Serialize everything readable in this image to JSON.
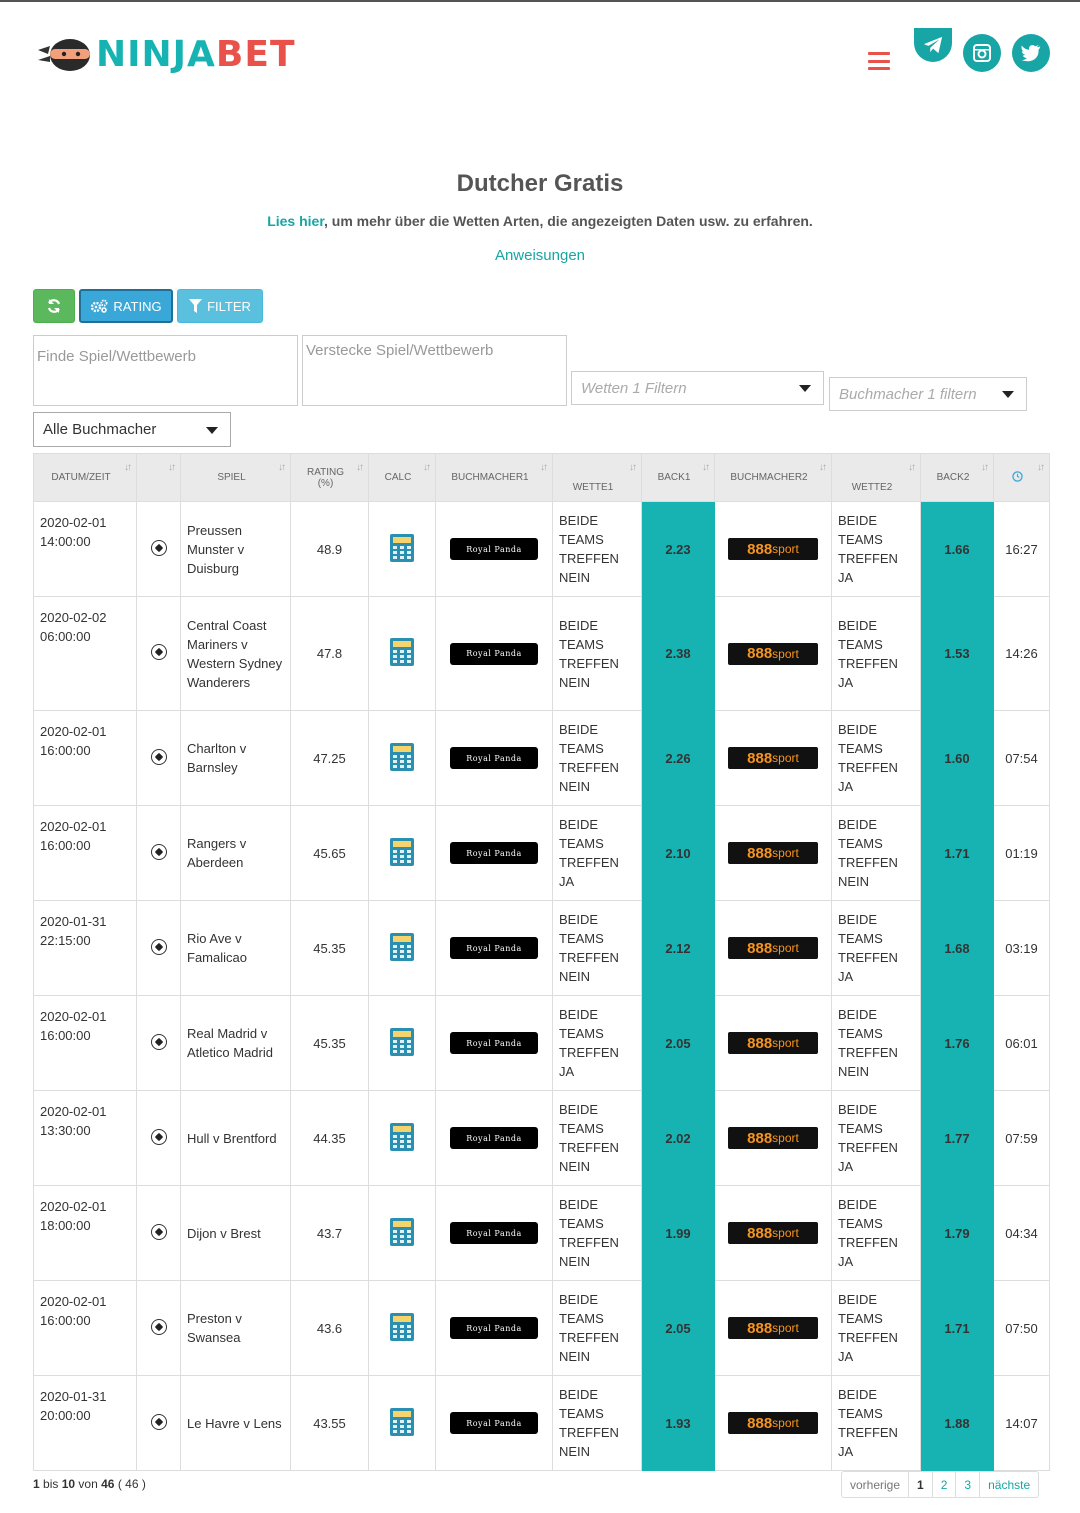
{
  "header": {
    "logo_ninja": "NINJA",
    "logo_bet": "BET"
  },
  "intro": {
    "title": "Dutcher Gratis",
    "lies_link": "Lies hier",
    "lies_rest": ", um mehr über die Wetten Arten, die angezeigten Daten usw. zu erfahren.",
    "instructions": "Anweisungen"
  },
  "toolbar": {
    "rating_label": "RATING",
    "filter_label": "FILTER"
  },
  "filters": {
    "find_placeholder": "Finde Spiel/Wettbewerb",
    "hide_placeholder": "Verstecke Spiel/Wettbewerb",
    "wetten_placeholder": "Wetten 1 Filtern",
    "buchmacher_placeholder": "Buchmacher 1 filtern",
    "alle_buchmacher": "Alle Buchmacher"
  },
  "table": {
    "columns": {
      "datum": "DATUM/ZEIT",
      "spiel": "SPIEL",
      "rating": "RATING",
      "rating_unit": "(%)",
      "calc": "CALC",
      "buch1": "BUCHMACHER1",
      "wette1": "WETTE1",
      "back1": "BACK1",
      "buch2": "BUCHMACHER2",
      "wette2": "WETTE2",
      "back2": "BACK2"
    },
    "bookmaker1": "Royal Panda",
    "bookmaker2_num": "888",
    "bookmaker2_word": "sport",
    "rows": [
      {
        "date": "2020-02-01",
        "time": "14:00:00",
        "game": "Preussen Munster v Duisburg",
        "rating": "48.9",
        "bet1": "BEIDE TEAMS TREFFEN NEIN",
        "back1": "2.23",
        "bet2": "BEIDE TEAMS TREFFEN JA",
        "back2": "1.66",
        "countdown": "16:27"
      },
      {
        "date": "2020-02-02",
        "time": "06:00:00",
        "game": "Central Coast Mariners v Western Sydney Wanderers",
        "rating": "47.8",
        "bet1": "BEIDE TEAMS TREFFEN NEIN",
        "back1": "2.38",
        "bet2": "BEIDE TEAMS TREFFEN JA",
        "back2": "1.53",
        "countdown": "14:26"
      },
      {
        "date": "2020-02-01",
        "time": "16:00:00",
        "game": "Charlton v Barnsley",
        "rating": "47.25",
        "bet1": "BEIDE TEAMS TREFFEN NEIN",
        "back1": "2.26",
        "bet2": "BEIDE TEAMS TREFFEN JA",
        "back2": "1.60",
        "countdown": "07:54"
      },
      {
        "date": "2020-02-01",
        "time": "16:00:00",
        "game": "Rangers v Aberdeen",
        "rating": "45.65",
        "bet1": "BEIDE TEAMS TREFFEN JA",
        "back1": "2.10",
        "bet2": "BEIDE TEAMS TREFFEN NEIN",
        "back2": "1.71",
        "countdown": "01:19"
      },
      {
        "date": "2020-01-31",
        "time": "22:15:00",
        "game": "Rio Ave v Famalicao",
        "rating": "45.35",
        "bet1": "BEIDE TEAMS TREFFEN NEIN",
        "back1": "2.12",
        "bet2": "BEIDE TEAMS TREFFEN JA",
        "back2": "1.68",
        "countdown": "03:19"
      },
      {
        "date": "2020-02-01",
        "time": "16:00:00",
        "game": "Real Madrid v Atletico Madrid",
        "rating": "45.35",
        "bet1": "BEIDE TEAMS TREFFEN JA",
        "back1": "2.05",
        "bet2": "BEIDE TEAMS TREFFEN NEIN",
        "back2": "1.76",
        "countdown": "06:01"
      },
      {
        "date": "2020-02-01",
        "time": "13:30:00",
        "game": "Hull v Brentford",
        "rating": "44.35",
        "bet1": "BEIDE TEAMS TREFFEN NEIN",
        "back1": "2.02",
        "bet2": "BEIDE TEAMS TREFFEN JA",
        "back2": "1.77",
        "countdown": "07:59"
      },
      {
        "date": "2020-02-01",
        "time": "18:00:00",
        "game": "Dijon v Brest",
        "rating": "43.7",
        "bet1": "BEIDE TEAMS TREFFEN NEIN",
        "back1": "1.99",
        "bet2": "BEIDE TEAMS TREFFEN JA",
        "back2": "1.79",
        "countdown": "04:34"
      },
      {
        "date": "2020-02-01",
        "time": "16:00:00",
        "game": "Preston v Swansea",
        "rating": "43.6",
        "bet1": "BEIDE TEAMS TREFFEN NEIN",
        "back1": "2.05",
        "bet2": "BEIDE TEAMS TREFFEN JA",
        "back2": "1.71",
        "countdown": "07:50"
      },
      {
        "date": "2020-01-31",
        "time": "20:00:00",
        "game": "Le Havre v Lens",
        "rating": "43.55",
        "bet1": "BEIDE TEAMS TREFFEN NEIN",
        "back1": "1.93",
        "bet2": "BEIDE TEAMS TREFFEN JA",
        "back2": "1.88",
        "countdown": "14:07"
      }
    ]
  },
  "footer": {
    "info_from": "1",
    "info_bis": "bis",
    "info_to": "10",
    "info_von": "von",
    "info_total": "46",
    "info_paren": "( 46 )",
    "prev": "vorherige",
    "pages": [
      "1",
      "2",
      "3"
    ],
    "next": "nächste"
  },
  "colors": {
    "teal": "#17b3b3",
    "coral": "#e8524a",
    "green": "#5cb85c",
    "blue": "#3aa7d9",
    "light_blue": "#5bc0de"
  },
  "icons": [
    "ninja-mask-icon",
    "hamburger-icon",
    "telegram-icon",
    "instagram-icon",
    "twitter-icon",
    "refresh-icon",
    "cogs-icon",
    "filter-icon",
    "clock-icon",
    "soccer-ball-icon",
    "calculator-icon"
  ]
}
